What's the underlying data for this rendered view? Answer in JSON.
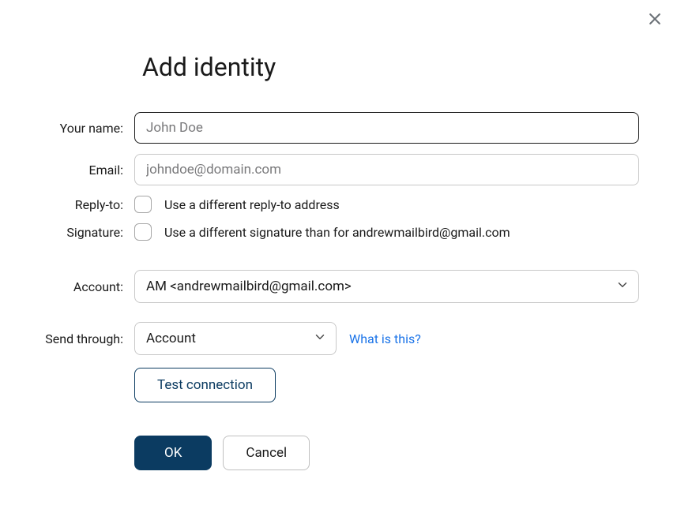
{
  "dialog": {
    "title": "Add identity"
  },
  "labels": {
    "your_name": "Your name:",
    "email": "Email:",
    "reply_to": "Reply-to:",
    "signature": "Signature:",
    "account": "Account:",
    "send_through": "Send through:"
  },
  "fields": {
    "your_name": {
      "placeholder": "John Doe",
      "value": ""
    },
    "email": {
      "placeholder": "johndoe@domain.com",
      "value": ""
    },
    "reply_to_checkbox_label": "Use a different reply-to address",
    "signature_checkbox_label": "Use a different signature than for andrewmailbird@gmail.com",
    "account_select": "AM <andrewmailbird@gmail.com>",
    "send_through_select": "Account"
  },
  "links": {
    "what_is_this": "What is this?"
  },
  "buttons": {
    "test_connection": "Test connection",
    "ok": "OK",
    "cancel": "Cancel"
  }
}
